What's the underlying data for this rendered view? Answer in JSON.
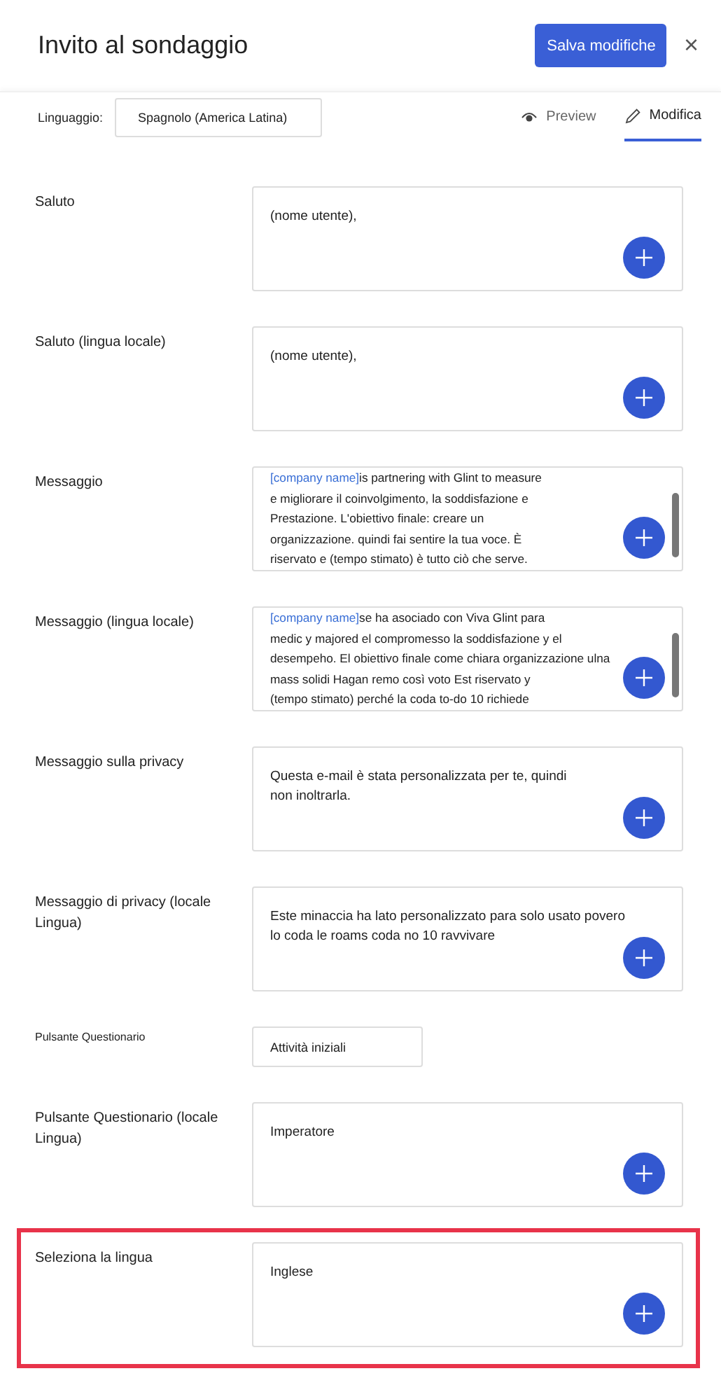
{
  "header": {
    "title": "Invito al sondaggio",
    "save_button": "Salva modifiche",
    "close": "×"
  },
  "toolbar": {
    "language_label": "Linguaggio:",
    "language_value": "Spagnolo (America Latina)",
    "tabs": [
      {
        "label": "Preview",
        "selected": false
      },
      {
        "label": "Modifica",
        "selected": true
      }
    ]
  },
  "fields": [
    {
      "label": "Saluto",
      "kind": "textarea",
      "lines": [
        "(nome utente),"
      ],
      "highlighted": false
    },
    {
      "label": "Saluto (lingua locale)",
      "kind": "textarea",
      "lines": [
        "(nome utente),"
      ],
      "highlighted": false
    },
    {
      "label": "Messaggio",
      "kind": "scroll",
      "token": "[company name]",
      "lines": [
        "is partnering with Glint to measure",
        "e migliorare il coinvolgimento, la soddisfazione e",
        "Prestazione. L'obiettivo finale: creare un",
        "organizzazione. quindi fai sentire la tua voce. È",
        "riservato e (tempo stimato) è tutto ciò che serve."
      ],
      "highlighted": false
    },
    {
      "label": "Messaggio (lingua locale)",
      "kind": "scroll",
      "token": "[company name]",
      "lines": [
        "se ha asociado con Viva Glint para",
        "medic y majored el compromesso la soddisfazione y el",
        "desempeho. El obiettivo finale come chiara organizzazione ulna",
        "mass solidi Hagan remo così voto Est riservato y",
        "(tempo stimato) perché la coda to-do 10 richiede"
      ],
      "highlighted": false
    },
    {
      "label": "Messaggio sulla privacy",
      "kind": "textarea",
      "lines": [
        "Questa e-mail è stata personalizzata per te, quindi",
        "non inoltrarla."
      ],
      "highlighted": false
    },
    {
      "label": "Messaggio di privacy (locale Lingua)",
      "kind": "textarea",
      "lines": [
        "Este minaccia ha lato personalizzato para solo usato povero",
        "lo coda le roams coda no 10 ravvivare"
      ],
      "highlighted": false
    },
    {
      "label": "Pulsante Questionario",
      "kind": "input",
      "lines": [
        "Attività iniziali"
      ],
      "highlighted": false
    },
    {
      "label": "Pulsante Questionario (locale Lingua)",
      "kind": "textarea",
      "lines": [
        "Imperatore"
      ],
      "highlighted": false
    },
    {
      "label": "Seleziona la lingua",
      "kind": "textarea",
      "lines": [
        "Inglese"
      ],
      "highlighted": true
    }
  ]
}
